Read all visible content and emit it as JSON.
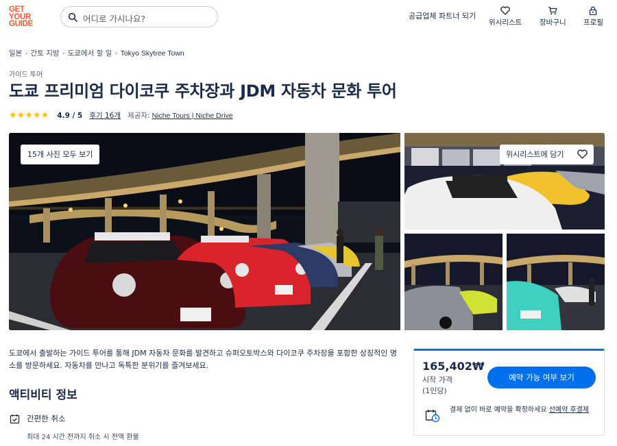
{
  "header": {
    "logo_line1": "GET",
    "logo_line2": "YOUR",
    "logo_line3": "GUIDE",
    "search_placeholder": "어디로 가시나요?",
    "partner": "공급업체 파트너 되기",
    "wishlist": "위시리스트",
    "cart": "장바구니",
    "profile": "프로필"
  },
  "breadcrumb": [
    "일본",
    "간토 지방",
    "도쿄에서 할 일",
    "Tokyo Skytree Town"
  ],
  "category": "가이드 투어",
  "title": "도쿄 프리미엄 다이코쿠 주차장과 JDM 자동차 문화 투어",
  "rating": {
    "stars": "★★★★★",
    "value": "4.9 / 5",
    "reviews": "후기 16개",
    "provider_label": "제공자:",
    "provider": "Niche Tours | Niche Drive"
  },
  "gallery": {
    "all_photos": "15개 사진 모두 보기",
    "add_wishlist": "위시리스트에 담기"
  },
  "description": "도쿄에서 출발하는 가이드 투어를 통해 JDM 자동차 문화를 발견하고 슈퍼오토박스와 다이코쿠 주차장을 포함한 상징적인 명소를 방문하세요. 자동차를 만나고 독특한 분위기를 즐겨보세요.",
  "activity_info": {
    "title": "액티비티 정보",
    "cancel_title": "간편한 취소",
    "cancel_sub": "최대 24 시간 전까지 취소 시 전액 환불"
  },
  "booking": {
    "price": "165,402₩",
    "price_label": "시작 가격",
    "per_person": "(1인당)",
    "button": "예약 가능 여부 보기",
    "note_prefix": "결제 없이 바로 예약을 확정하세요",
    "note_link": "선예약 후결제"
  },
  "colors": {
    "brand": "#ff5533",
    "primary": "#0071eb",
    "text": "#1a2b49",
    "star": "#ffbe0a"
  }
}
